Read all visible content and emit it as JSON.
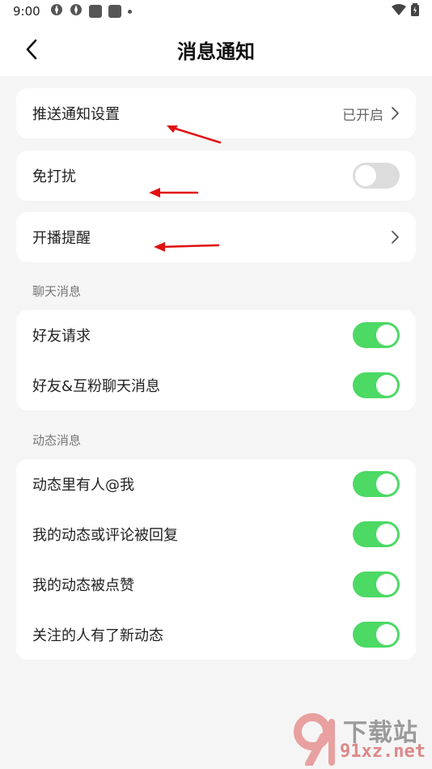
{
  "status_bar": {
    "time": "9:00"
  },
  "header": {
    "title": "消息通知"
  },
  "top_settings": {
    "push": {
      "label": "推送通知设置",
      "status": "已开启"
    },
    "dnd": {
      "label": "免打扰",
      "enabled": false
    },
    "live": {
      "label": "开播提醒"
    }
  },
  "chat": {
    "section_title": "聊天消息",
    "items": [
      {
        "label": "好友请求",
        "enabled": true
      },
      {
        "label": "好友&互粉聊天消息",
        "enabled": true
      }
    ]
  },
  "feed": {
    "section_title": "动态消息",
    "items": [
      {
        "label": "动态里有人@我",
        "enabled": true
      },
      {
        "label": "我的动态或评论被回复",
        "enabled": true
      },
      {
        "label": "我的动态被点赞",
        "enabled": true
      },
      {
        "label": "关注的人有了新动态",
        "enabled": true
      }
    ]
  },
  "colors": {
    "toggle_on": "#4cd964",
    "toggle_off": "#dcdcdc",
    "annotation_arrow": "#e01010"
  },
  "watermark": {
    "line1": "下载站",
    "line2": "91xz.net"
  }
}
